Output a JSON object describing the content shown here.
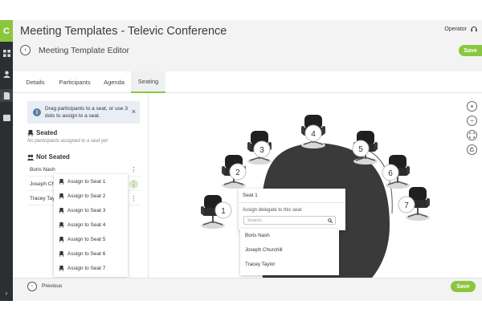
{
  "window": {
    "title": "Meeting Templates - Televic Conference",
    "user": "Operator"
  },
  "rail": {
    "logo": "C"
  },
  "header": {
    "page_title": "Meeting Template Editor",
    "save_label": "Save"
  },
  "tabs": [
    "Details",
    "Participants",
    "Agenda",
    "Seating"
  ],
  "active_tab": "Seating",
  "left": {
    "info": "Drag participants to a seat, or use 3 dots to assign to a seat.",
    "seated_heading": "Seated",
    "seated_empty": "No participants assigned to a seat yet",
    "not_seated_heading": "Not Seated",
    "participants": [
      "Boris Nash",
      "Joseph Chu",
      "Tracey Tay"
    ]
  },
  "seat_menu": [
    "Assign to Seat 1",
    "Assign to Seat 2",
    "Assign to Seat 3",
    "Assign to Seat 4",
    "Assign to Seat 5",
    "Assign to Seat 6",
    "Assign to Seat 7"
  ],
  "seats": [
    "1",
    "2",
    "3",
    "4",
    "5",
    "6",
    "7"
  ],
  "popup": {
    "seat_title": "Seat 1",
    "assign_label": "Assign delegate to this seat",
    "search_placeholder": "Search..",
    "options": [
      "Boris Nash",
      "Joseph Churchill",
      "Tracey Taylor"
    ]
  },
  "footer": {
    "previous_label": "Previous",
    "save_label": "Save"
  },
  "colors": {
    "accent": "#8cc63f",
    "sidebar": "#2b2e33",
    "table": "#3a3a3a"
  }
}
